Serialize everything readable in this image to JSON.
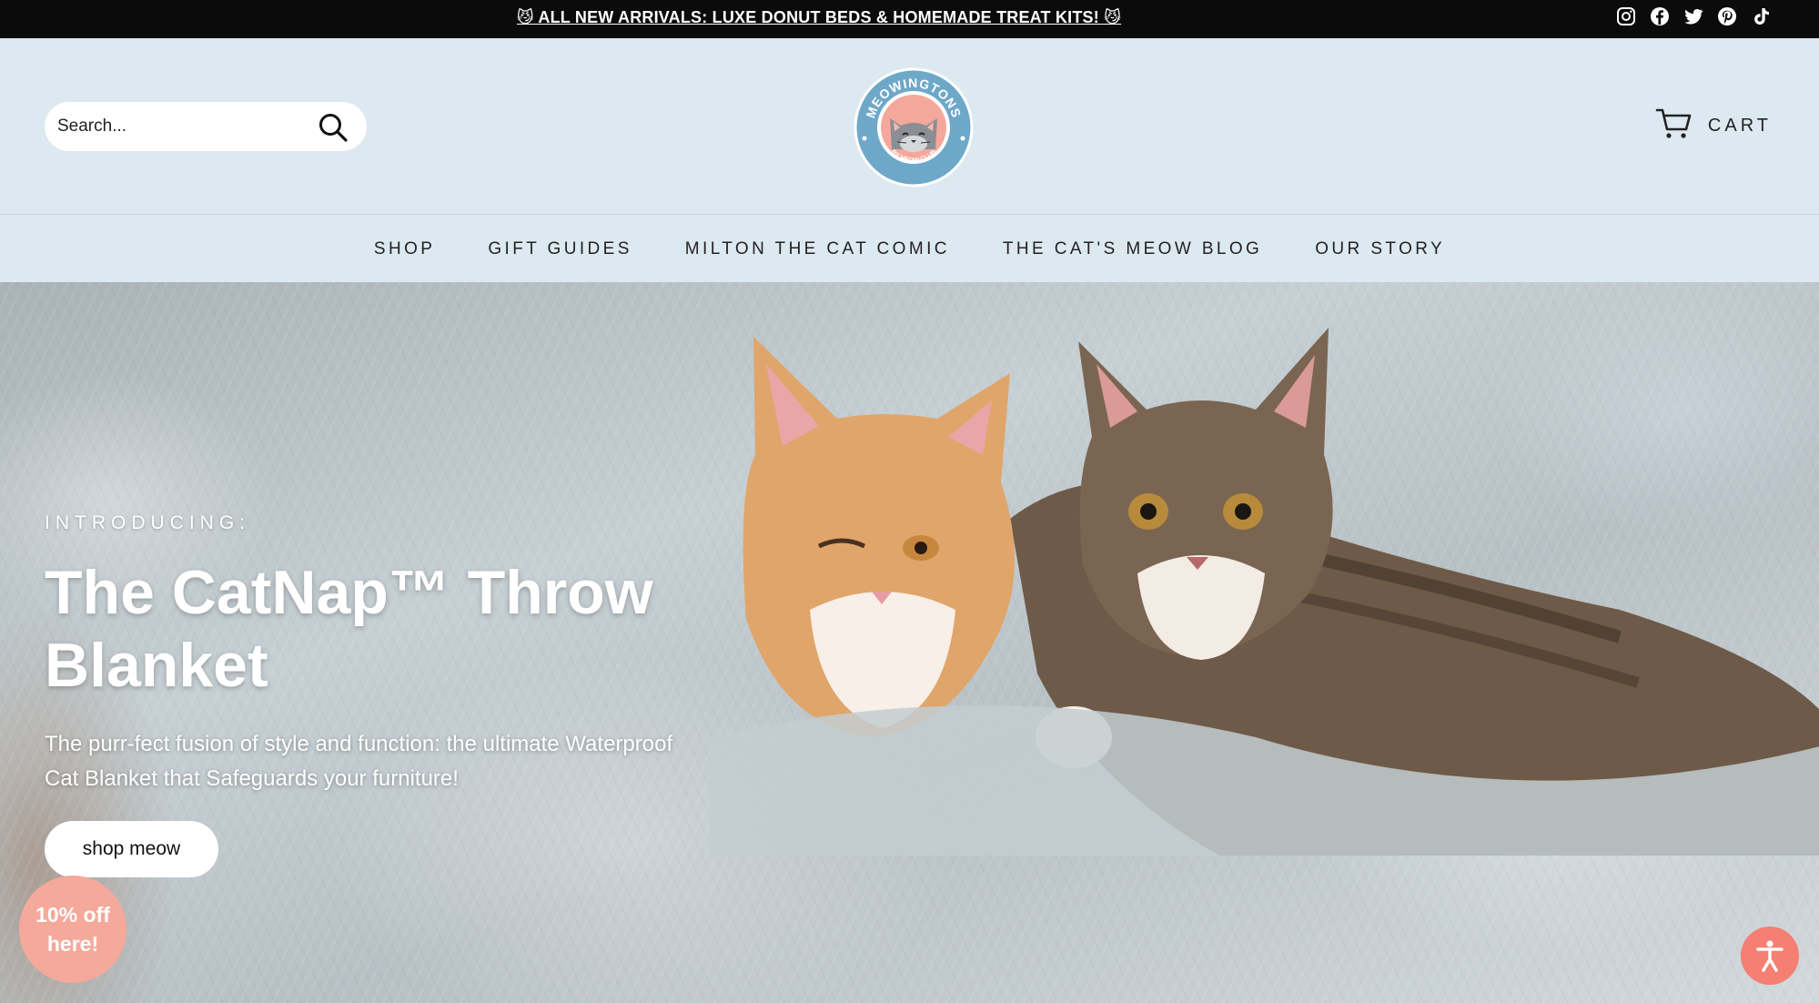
{
  "announcement": {
    "text": "😼 ALL NEW ARRIVALS: LUXE DONUT BEDS & HOMEMADE TREAT KITS! 😼"
  },
  "social": [
    "instagram-icon",
    "facebook-icon",
    "twitter-icon",
    "pinterest-icon",
    "tiktok-icon"
  ],
  "header": {
    "search_placeholder": "Search...",
    "logo_text": "MEOWINGTONS",
    "logo_subtext": "BY MEOW CLUB",
    "cart_label": "CART"
  },
  "nav": [
    "SHOP",
    "GIFT GUIDES",
    "MILTON THE CAT COMIC",
    "THE CAT'S MEOW BLOG",
    "OUR STORY"
  ],
  "hero": {
    "eyebrow": "INTRODUCING:",
    "title": "The CatNap™ Throw Blanket",
    "subtitle": "The purr-fect fusion of style and function: the ultimate Waterproof Cat Blanket that Safeguards your furniture!",
    "cta": "shop meow"
  },
  "discount_badge": "10% off here!",
  "colors": {
    "announce_bg": "#0b0b0b",
    "header_bg": "#dde9f0",
    "badge": "#f4a99b",
    "accessibility": "#f47f72"
  }
}
